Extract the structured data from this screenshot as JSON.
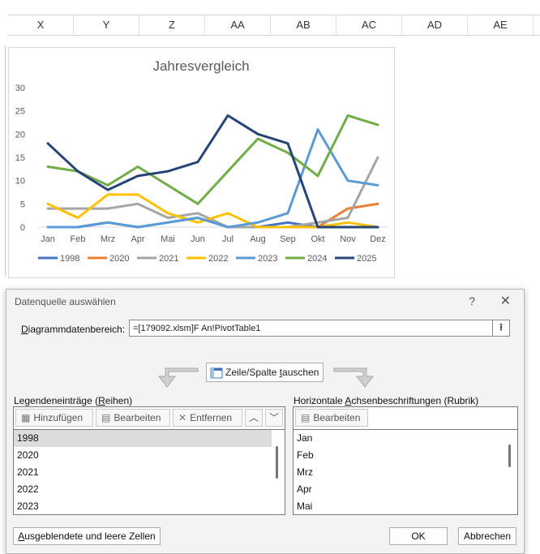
{
  "sheet": {
    "columns": [
      "X",
      "Y",
      "Z",
      "AA",
      "AB",
      "AC",
      "AD",
      "AE"
    ]
  },
  "chart_data": {
    "type": "line",
    "title": "Jahresvergleich",
    "categories": [
      "Jan",
      "Feb",
      "Mrz",
      "Apr",
      "Mai",
      "Jun",
      "Jul",
      "Aug",
      "Sep",
      "Okt",
      "Nov",
      "Dez"
    ],
    "ylim": [
      0,
      30
    ],
    "yticks": [
      0,
      5,
      10,
      15,
      20,
      25,
      30
    ],
    "grid": false,
    "legend_position": "bottom",
    "series": [
      {
        "name": "1998",
        "color": "#4472c4",
        "values": [
          0,
          0,
          1,
          0,
          1,
          2,
          0,
          0,
          1,
          0,
          null,
          null
        ]
      },
      {
        "name": "2020",
        "color": "#ed7d31",
        "values": [
          null,
          null,
          null,
          null,
          null,
          null,
          null,
          null,
          null,
          0,
          4,
          5
        ]
      },
      {
        "name": "2021",
        "color": "#a5a5a5",
        "values": [
          4,
          4,
          4,
          5,
          2,
          3,
          0,
          0,
          0,
          1,
          2,
          15
        ]
      },
      {
        "name": "2022",
        "color": "#ffc000",
        "values": [
          5,
          2,
          7,
          7,
          3,
          1,
          3,
          0,
          0,
          0,
          1,
          0
        ]
      },
      {
        "name": "2023",
        "color": "#5b9bd5",
        "values": [
          0,
          0,
          1,
          0,
          1,
          2,
          0,
          1,
          3,
          21,
          10,
          9
        ]
      },
      {
        "name": "2024",
        "color": "#70ad47",
        "values": [
          13,
          12,
          9,
          13,
          9,
          5,
          12,
          19,
          16,
          11,
          24,
          22
        ]
      },
      {
        "name": "2025",
        "color": "#264478",
        "values": [
          18,
          12,
          8,
          11,
          12,
          14,
          24,
          20,
          18,
          0,
          0,
          0
        ]
      }
    ]
  },
  "dialog": {
    "title": "Datenquelle auswählen",
    "help_icon": "?",
    "close_icon": "close-icon",
    "range_label": "Diagrammdatenbereich:",
    "range_value": "=[179092.xlsm]F An!PivotTable1",
    "swap_label": "Zeile/Spalte tauschen",
    "legend_group": {
      "label": "Legendeneinträge (Reihen)",
      "add_label": "Hinzufügen",
      "edit_label": "Bearbeiten",
      "remove_label": "Entfernen",
      "items": [
        "1998",
        "2020",
        "2021",
        "2022",
        "2023"
      ]
    },
    "axis_group": {
      "label": "Horizontale Achsenbeschriftungen (Rubrik)",
      "edit_label": "Bearbeiten",
      "items": [
        "Jan",
        "Feb",
        "Mrz",
        "Apr",
        "Mai"
      ]
    },
    "hidden_cells_label": "Ausgeblendete und leere Zellen",
    "ok_label": "OK",
    "cancel_label": "Abbrechen"
  }
}
